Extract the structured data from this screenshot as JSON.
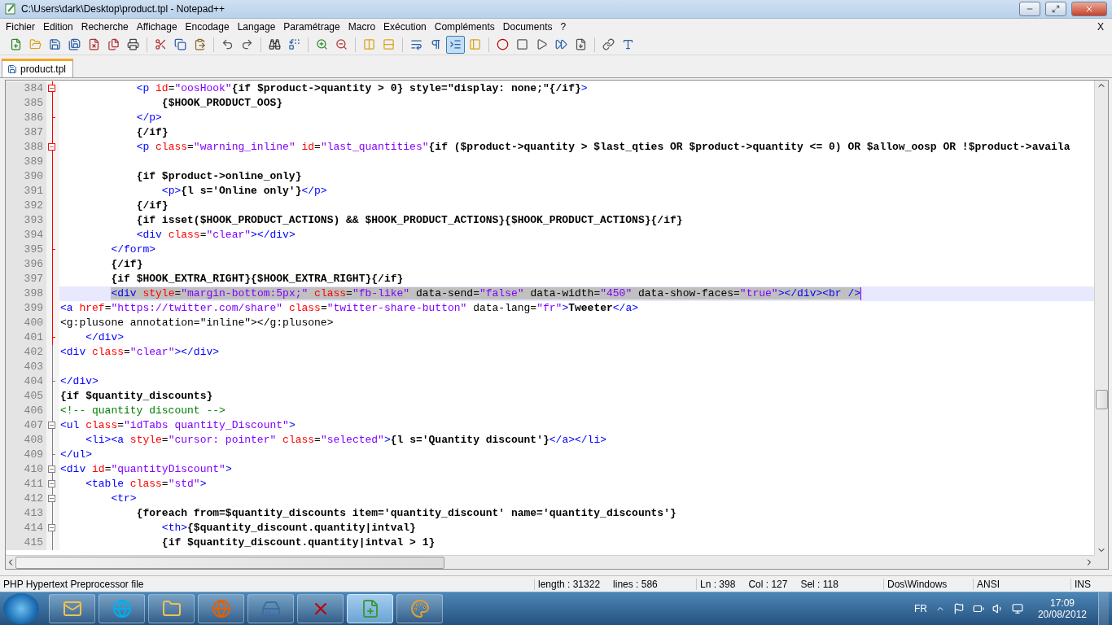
{
  "window": {
    "title": "C:\\Users\\dark\\Desktop\\product.tpl - Notepad++"
  },
  "menu": {
    "items": [
      "Fichier",
      "Edition",
      "Recherche",
      "Affichage",
      "Encodage",
      "Langage",
      "Paramétrage",
      "Macro",
      "Exécution",
      "Compléments",
      "Documents",
      "?"
    ],
    "close_label": "X"
  },
  "toolbar": [
    {
      "pressed": false
    },
    {
      "pressed": false
    },
    {
      "pressed": false
    },
    {
      "pressed": false
    },
    {
      "pressed": false
    },
    {
      "pressed": false
    },
    {
      "pressed": false
    },
    {
      "pressed": false
    },
    {
      "pressed": false
    },
    {
      "pressed": false
    },
    {
      "pressed": false
    },
    {
      "pressed": false
    },
    {
      "pressed": false
    },
    {
      "pressed": false
    },
    {
      "pressed": false
    },
    {
      "pressed": false
    },
    {
      "pressed": false
    },
    {
      "pressed": false
    },
    {
      "pressed": false
    },
    {
      "pressed": false
    },
    {
      "pressed": true
    },
    {
      "pressed": false
    },
    {
      "pressed": false
    },
    {
      "pressed": false
    },
    {
      "pressed": false
    },
    {
      "pressed": false
    },
    {
      "pressed": false
    },
    {
      "pressed": false
    },
    {
      "pressed": false
    }
  ],
  "tabs": [
    {
      "label": "product.tpl",
      "selected": true
    }
  ],
  "editor": {
    "lines": [
      {
        "number": "384",
        "fold_open": true,
        "fold_end": false,
        "active_fold": true,
        "selected": false,
        "tokens": [
          {
            "kind": "tag",
            "text": "            <p "
          },
          {
            "kind": "attr",
            "text": "id"
          },
          {
            "kind": "op",
            "text": "="
          },
          {
            "kind": "str",
            "text": "\"oosHook\""
          },
          {
            "kind": "text",
            "text": "{if $product->quantity > 0} style=\"display: none;\"{/if}"
          },
          {
            "kind": "tag",
            "text": ">"
          }
        ]
      },
      {
        "number": "385",
        "fold_open": false,
        "fold_end": false,
        "active_fold": true,
        "selected": false,
        "tokens": [
          {
            "kind": "text",
            "text": "                {$HOOK_PRODUCT_OOS}"
          }
        ]
      },
      {
        "number": "386",
        "fold_open": false,
        "fold_end": true,
        "active_fold": true,
        "selected": false,
        "tokens": [
          {
            "kind": "tag",
            "text": "            </p>"
          }
        ]
      },
      {
        "number": "387",
        "fold_open": false,
        "fold_end": false,
        "active_fold": true,
        "selected": false,
        "tokens": [
          {
            "kind": "text",
            "text": "            {/if}"
          }
        ]
      },
      {
        "number": "388",
        "fold_open": true,
        "fold_end": false,
        "active_fold": true,
        "selected": false,
        "tokens": [
          {
            "kind": "tag",
            "text": "            <p "
          },
          {
            "kind": "attr",
            "text": "class"
          },
          {
            "kind": "op",
            "text": "="
          },
          {
            "kind": "str",
            "text": "\"warning_inline\""
          },
          {
            "kind": "attr",
            "text": " id"
          },
          {
            "kind": "op",
            "text": "="
          },
          {
            "kind": "str",
            "text": "\"last_quantities\""
          },
          {
            "kind": "text",
            "text": "{if ($product->quantity > $last_qties OR $product->quantity <= 0) OR $allow_oosp OR !$product->availa"
          }
        ]
      },
      {
        "number": "389",
        "fold_open": false,
        "fold_end": false,
        "active_fold": true,
        "selected": false
      },
      {
        "number": "390",
        "fold_open": false,
        "fold_end": false,
        "active_fold": true,
        "selected": false,
        "tokens": [
          {
            "kind": "text",
            "text": "            {if $product->online_only}"
          }
        ]
      },
      {
        "number": "391",
        "fold_open": false,
        "fold_end": false,
        "active_fold": true,
        "selected": false,
        "tokens": [
          {
            "kind": "tag",
            "text": "                <p>"
          },
          {
            "kind": "text",
            "text": "{l s='Online only'}"
          },
          {
            "kind": "tag",
            "text": "</p>"
          }
        ]
      },
      {
        "number": "392",
        "fold_open": false,
        "fold_end": false,
        "active_fold": true,
        "selected": false,
        "tokens": [
          {
            "kind": "text",
            "text": "            {/if}"
          }
        ]
      },
      {
        "number": "393",
        "fold_open": false,
        "fold_end": false,
        "active_fold": true,
        "selected": false,
        "tokens": [
          {
            "kind": "text",
            "text": "            {if isset($HOOK_PRODUCT_ACTIONS) && $HOOK_PRODUCT_ACTIONS}{$HOOK_PRODUCT_ACTIONS}{/if}"
          }
        ]
      },
      {
        "number": "394",
        "fold_open": false,
        "fold_end": false,
        "active_fold": true,
        "selected": false,
        "tokens": [
          {
            "kind": "tag",
            "text": "            <div "
          },
          {
            "kind": "attr",
            "text": "class"
          },
          {
            "kind": "op",
            "text": "="
          },
          {
            "kind": "str",
            "text": "\"clear\""
          },
          {
            "kind": "tag",
            "text": "></div>"
          }
        ]
      },
      {
        "number": "395",
        "fold_open": false,
        "fold_end": true,
        "active_fold": true,
        "selected": false,
        "tokens": [
          {
            "kind": "tag",
            "text": "        </form>"
          }
        ]
      },
      {
        "number": "396",
        "fold_open": false,
        "fold_end": false,
        "active_fold": true,
        "selected": false,
        "tokens": [
          {
            "kind": "text",
            "text": "        {/if}"
          }
        ]
      },
      {
        "number": "397",
        "fold_open": false,
        "fold_end": false,
        "active_fold": true,
        "selected": false,
        "tokens": [
          {
            "kind": "text",
            "text": "        {if $HOOK_EXTRA_RIGHT}{$HOOK_EXTRA_RIGHT}{/if}"
          }
        ]
      },
      {
        "number": "398",
        "fold_open": false,
        "fold_end": false,
        "active_fold": true,
        "selected": true,
        "tokens": [
          {
            "kind": "tag",
            "text": "        <div "
          },
          {
            "kind": "attr",
            "text": "style"
          },
          {
            "kind": "op",
            "text": "="
          },
          {
            "kind": "str",
            "text": "\"margin-bottom:5px;\""
          },
          {
            "kind": "attr",
            "text": " class"
          },
          {
            "kind": "op",
            "text": "="
          },
          {
            "kind": "str",
            "text": "\"fb-like\""
          },
          {
            "kind": "op",
            "text": " data-send="
          },
          {
            "kind": "str",
            "text": "\"false\""
          },
          {
            "kind": "op",
            "text": " data-width="
          },
          {
            "kind": "str",
            "text": "\"450\""
          },
          {
            "kind": "op",
            "text": " data-show-faces="
          },
          {
            "kind": "str",
            "text": "\"true\""
          },
          {
            "kind": "tag",
            "text": "></div><br />"
          }
        ]
      },
      {
        "number": "399",
        "fold_open": false,
        "fold_end": false,
        "active_fold": true,
        "selected": false,
        "tokens": [
          {
            "kind": "tag",
            "text": "<a "
          },
          {
            "kind": "attr",
            "text": "href"
          },
          {
            "kind": "op",
            "text": "="
          },
          {
            "kind": "str",
            "text": "\"https://twitter.com/share\""
          },
          {
            "kind": "attr",
            "text": " class"
          },
          {
            "kind": "op",
            "text": "="
          },
          {
            "kind": "str",
            "text": "\"twitter-share-button\""
          },
          {
            "kind": "op",
            "text": " data-lang="
          },
          {
            "kind": "str",
            "text": "\"fr\""
          },
          {
            "kind": "tag",
            "text": ">"
          },
          {
            "kind": "text",
            "text": "Tweeter"
          },
          {
            "kind": "tag",
            "text": "</a>"
          }
        ]
      },
      {
        "number": "400",
        "fold_open": false,
        "fold_end": false,
        "active_fold": true,
        "selected": false,
        "tokens": [
          {
            "kind": "op",
            "text": "<g:plusone annotation=\"inline\"></g:plusone>"
          }
        ]
      },
      {
        "number": "401",
        "fold_open": false,
        "fold_end": true,
        "active_fold": true,
        "selected": false,
        "tokens": [
          {
            "kind": "tag",
            "text": "    </div>"
          }
        ]
      },
      {
        "number": "402",
        "fold_open": false,
        "fold_end": false,
        "active_fold": false,
        "selected": false,
        "tokens": [
          {
            "kind": "tag",
            "text": "<div "
          },
          {
            "kind": "attr",
            "text": "class"
          },
          {
            "kind": "op",
            "text": "="
          },
          {
            "kind": "str",
            "text": "\"clear\""
          },
          {
            "kind": "tag",
            "text": "></div>"
          }
        ]
      },
      {
        "number": "403",
        "fold_open": false,
        "fold_end": false,
        "active_fold": false,
        "selected": false
      },
      {
        "number": "404",
        "fold_open": false,
        "fold_end": true,
        "active_fold": false,
        "selected": false,
        "tokens": [
          {
            "kind": "tag",
            "text": "</div>"
          }
        ]
      },
      {
        "number": "405",
        "fold_open": false,
        "fold_end": false,
        "active_fold": false,
        "selected": false,
        "tokens": [
          {
            "kind": "text",
            "text": "{if $quantity_discounts}"
          }
        ]
      },
      {
        "number": "406",
        "fold_open": false,
        "fold_end": false,
        "active_fold": false,
        "selected": false,
        "tokens": [
          {
            "kind": "comment",
            "text": "<!-- quantity discount -->"
          }
        ]
      },
      {
        "number": "407",
        "fold_open": true,
        "fold_end": false,
        "active_fold": false,
        "selected": false,
        "tokens": [
          {
            "kind": "tag",
            "text": "<ul "
          },
          {
            "kind": "attr",
            "text": "class"
          },
          {
            "kind": "op",
            "text": "="
          },
          {
            "kind": "str",
            "text": "\"idTabs quantity_Discount\""
          },
          {
            "kind": "tag",
            "text": ">"
          }
        ]
      },
      {
        "number": "408",
        "fold_open": false,
        "fold_end": false,
        "active_fold": false,
        "selected": false,
        "tokens": [
          {
            "kind": "tag",
            "text": "    <li><a "
          },
          {
            "kind": "attr",
            "text": "style"
          },
          {
            "kind": "op",
            "text": "="
          },
          {
            "kind": "str",
            "text": "\"cursor: pointer\""
          },
          {
            "kind": "attr",
            "text": " class"
          },
          {
            "kind": "op",
            "text": "="
          },
          {
            "kind": "str",
            "text": "\"selected\""
          },
          {
            "kind": "tag",
            "text": ">"
          },
          {
            "kind": "text",
            "text": "{l s='Quantity discount'}"
          },
          {
            "kind": "tag",
            "text": "</a></li>"
          }
        ]
      },
      {
        "number": "409",
        "fold_open": false,
        "fold_end": true,
        "active_fold": false,
        "selected": false,
        "tokens": [
          {
            "kind": "tag",
            "text": "</ul>"
          }
        ]
      },
      {
        "number": "410",
        "fold_open": true,
        "fold_end": false,
        "active_fold": false,
        "selected": false,
        "tokens": [
          {
            "kind": "tag",
            "text": "<div "
          },
          {
            "kind": "attr",
            "text": "id"
          },
          {
            "kind": "op",
            "text": "="
          },
          {
            "kind": "str",
            "text": "\"quantityDiscount\""
          },
          {
            "kind": "tag",
            "text": ">"
          }
        ]
      },
      {
        "number": "411",
        "fold_open": true,
        "fold_end": false,
        "active_fold": false,
        "selected": false,
        "tokens": [
          {
            "kind": "tag",
            "text": "    <table "
          },
          {
            "kind": "attr",
            "text": "class"
          },
          {
            "kind": "op",
            "text": "="
          },
          {
            "kind": "str",
            "text": "\"std\""
          },
          {
            "kind": "tag",
            "text": ">"
          }
        ]
      },
      {
        "number": "412",
        "fold_open": true,
        "fold_end": false,
        "active_fold": false,
        "selected": false,
        "tokens": [
          {
            "kind": "tag",
            "text": "        <tr>"
          }
        ]
      },
      {
        "number": "413",
        "fold_open": false,
        "fold_end": false,
        "active_fold": false,
        "selected": false,
        "tokens": [
          {
            "kind": "text",
            "text": "            {foreach from=$quantity_discounts item='quantity_discount' name='quantity_discounts'}"
          }
        ]
      },
      {
        "number": "414",
        "fold_open": true,
        "fold_end": false,
        "active_fold": false,
        "selected": false,
        "tokens": [
          {
            "kind": "tag",
            "text": "                <th>"
          },
          {
            "kind": "text",
            "text": "{$quantity_discount.quantity|intval}"
          }
        ]
      },
      {
        "number": "415",
        "fold_open": false,
        "fold_end": false,
        "active_fold": false,
        "selected": false,
        "tokens": [
          {
            "kind": "text",
            "text": "                {if $quantity_discount.quantity|intval > 1}"
          }
        ]
      }
    ]
  },
  "status_bar": {
    "file_type": "PHP Hypertext Preprocessor file",
    "length": "length : 31322",
    "lines": "lines : 586",
    "ln": "Ln : 398",
    "col": "Col : 127",
    "sel": "Sel : 118",
    "eol": "Dos\\Windows",
    "encoding": "ANSI",
    "mode": "INS"
  },
  "taskbar": {
    "apps": [
      {
        "selected": false
      },
      {
        "selected": false
      },
      {
        "selected": false
      },
      {
        "selected": false
      },
      {
        "selected": false
      },
      {
        "selected": false
      },
      {
        "selected": true
      },
      {
        "selected": false
      }
    ],
    "language": "FR",
    "time": "17:09",
    "date": "20/08/2012"
  }
}
